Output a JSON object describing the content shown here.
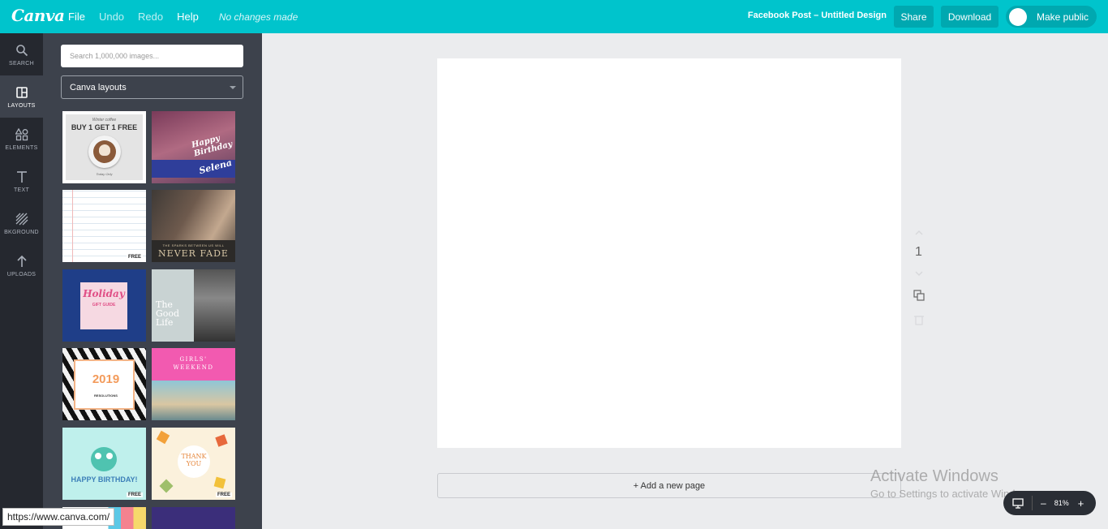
{
  "app": {
    "logo": "Canva"
  },
  "menu": {
    "file": "File",
    "undo": "Undo",
    "redo": "Redo",
    "help": "Help",
    "status": "No changes made"
  },
  "document": {
    "title": "Facebook Post – Untitled Design"
  },
  "actions": {
    "share": "Share",
    "download": "Download",
    "make_public": "Make public"
  },
  "nav": {
    "search": "SEARCH",
    "layouts": "LAYOUTS",
    "elements": "ELEMENTS",
    "text": "TEXT",
    "background": "BKGROUND",
    "uploads": "UPLOADS"
  },
  "panel": {
    "search_placeholder": "Search 1,000,000 images...",
    "category": "Canva layouts"
  },
  "layouts": {
    "coffee": {
      "top": "Winter coffee",
      "headline": "BUY 1 GET 1 FREE",
      "sub": "Today Only"
    },
    "birthday": {
      "headline": "Happy Birthday",
      "name": "Selena"
    },
    "letter": {
      "free": "FREE"
    },
    "never_fade": {
      "caption": "THE SPARKS BETWEEN US WILL",
      "headline": "NEVER FADE"
    },
    "holiday": {
      "headline": "Holiday",
      "sub": "GIFT GUIDE"
    },
    "good_life": {
      "line1": "The",
      "line2": "Good",
      "line3": "Life"
    },
    "year": {
      "number": "2019",
      "sub": "RESOLUTIONS"
    },
    "girls_weekend": {
      "line1": "GIRLS'",
      "line2": "WEEKEND"
    },
    "happy_birthday": {
      "headline": "HAPPY BIRTHDAY!",
      "free": "FREE"
    },
    "thank_you": {
      "line1": "THANK",
      "line2": "YOU",
      "free": "FREE"
    }
  },
  "canvas": {
    "page_number": "1",
    "add_page": "+ Add a new page"
  },
  "zoom": {
    "minus": "–",
    "percent": "81%",
    "plus": "+"
  },
  "watermark": {
    "title": "Activate Windows",
    "subtitle": "Go to Settings to activate Windows."
  },
  "status_url": "https://www.canva.com/",
  "colors": {
    "brand": "#00c4cc",
    "nav": "#25282f",
    "panel": "#3d424c"
  }
}
